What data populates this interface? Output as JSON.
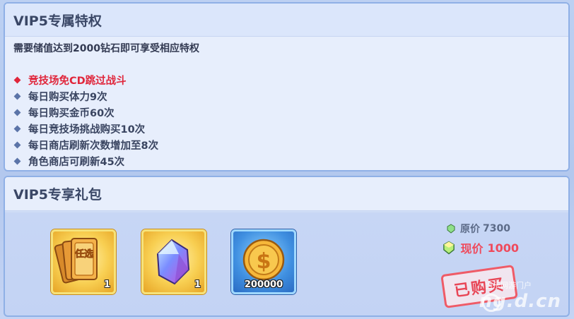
{
  "privileges": {
    "title": "VIP5专属特权",
    "requirement": "需要储值达到2000钻石即可享受相应特权",
    "items": [
      {
        "text": "竞技场免CD跳过战斗",
        "highlight": true
      },
      {
        "text": "每日购买体力9次",
        "highlight": false
      },
      {
        "text": "每日购买金币60次",
        "highlight": false
      },
      {
        "text": "每日竞技场挑战购买10次",
        "highlight": false
      },
      {
        "text": "每日商店刷新次数增加至8次",
        "highlight": false
      },
      {
        "text": "角色商店可刷新45次",
        "highlight": false
      }
    ]
  },
  "gift": {
    "title": "VIP5专享礼包",
    "items": [
      {
        "icon": "selection-card-icon",
        "card_text": "任选",
        "quantity": "1"
      },
      {
        "icon": "diamond-gem-icon",
        "quantity": "1"
      },
      {
        "icon": "gold-coin-icon",
        "quantity": "200000"
      }
    ],
    "original_price_label": "原价",
    "original_price": "7300",
    "current_price_label": "现价",
    "current_price": "1000",
    "purchased_stamp": "已购买"
  },
  "watermark": {
    "line1": "当乐网游门户",
    "line2": "ng.d.cn"
  },
  "colors": {
    "highlight": "#e0263b",
    "price_current": "#ef4a5c",
    "stamp": "#e84656"
  }
}
